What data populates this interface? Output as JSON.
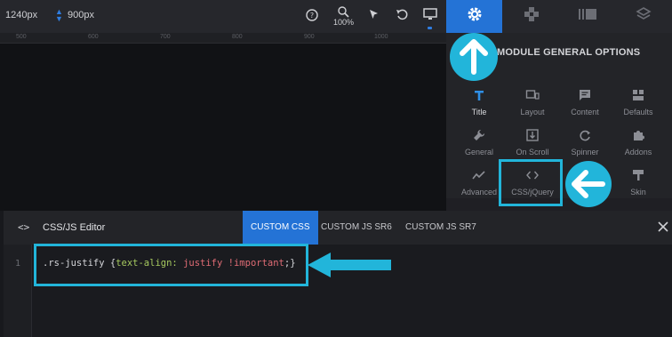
{
  "toolbar": {
    "width_label": "1240px",
    "height_label": "900px",
    "zoom_label": "100%",
    "icons": [
      "help-icon",
      "zoom-icon",
      "pointer-icon",
      "undo-icon",
      "desktop-icon"
    ]
  },
  "right_tabs": [
    {
      "name": "settings",
      "icon": "gear-icon",
      "active": true
    },
    {
      "name": "modules",
      "icon": "puzzle-icon",
      "active": false
    },
    {
      "name": "media",
      "icon": "gallery-icon",
      "active": false
    },
    {
      "name": "layers",
      "icon": "layers-icon",
      "active": false
    }
  ],
  "ruler": {
    "ticks": [
      "500",
      "600",
      "700",
      "800",
      "900",
      "1000"
    ]
  },
  "panel": {
    "title": "MODULE GENERAL OPTIONS",
    "options": [
      {
        "label": "Title",
        "icon": "title-icon",
        "active": true
      },
      {
        "label": "Layout",
        "icon": "layout-icon",
        "active": false
      },
      {
        "label": "Content",
        "icon": "content-icon",
        "active": false
      },
      {
        "label": "Defaults",
        "icon": "defaults-icon",
        "active": false
      },
      {
        "label": "General",
        "icon": "wrench-icon",
        "active": false
      },
      {
        "label": "On Scroll",
        "icon": "on-scroll-icon",
        "active": false
      },
      {
        "label": "Spinner",
        "icon": "spinner-icon",
        "active": false
      },
      {
        "label": "Addons",
        "icon": "addons-icon",
        "active": false
      },
      {
        "label": "Advanced",
        "icon": "advanced-icon",
        "active": false
      },
      {
        "label": "CSS/jQuery",
        "icon": "code-icon",
        "active": false
      },
      {
        "label": "",
        "icon": "",
        "active": false
      },
      {
        "label": "Skin",
        "icon": "skin-icon",
        "active": false
      }
    ]
  },
  "editor": {
    "title": "CSS/JS Editor",
    "code_icon": "<>",
    "tabs": [
      {
        "label": "CUSTOM CSS",
        "active": true
      },
      {
        "label": "CUSTOM JS SR6",
        "active": false
      },
      {
        "label": "CUSTOM JS SR7",
        "active": false
      }
    ],
    "line_number": "1",
    "code": {
      "selector": ".rs-justify {",
      "property": "text-align:",
      "value": "justify",
      "important": "!important",
      "end": ";}"
    }
  },
  "colors": {
    "accent": "#2473d6",
    "annotation": "#22b5da",
    "background": "#18191d"
  }
}
